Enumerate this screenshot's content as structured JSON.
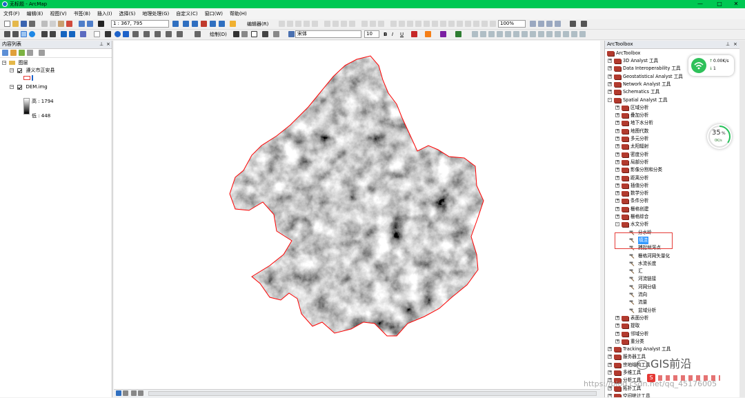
{
  "window": {
    "title": "无标题 - ArcMap",
    "controls": [
      "—",
      "□",
      "✕"
    ]
  },
  "menu": [
    "文件(F)",
    "编辑(E)",
    "视图(V)",
    "书签(B)",
    "插入(I)",
    "选择(S)",
    "地理处理(G)",
    "自定义(C)",
    "窗口(W)",
    "帮助(H)"
  ],
  "toolbar": {
    "scale": "1 : 367, 795",
    "editor_label": "编辑器(R)",
    "draw_label": "绘制(D)",
    "font_name": "宋体",
    "font_size": "10",
    "zoom_percent": "100%"
  },
  "toc": {
    "title": "内容列表",
    "layers_group": "图层",
    "layer1": "遵义市正安县",
    "layer2": "DEM.img",
    "high_label": "高 : 1794",
    "low_label": "低 : 448"
  },
  "toolbox": {
    "title": "ArcToolbox",
    "root": "ArcToolbox",
    "items": [
      {
        "level": 0,
        "exp": "+",
        "icon": "box",
        "label": "3D Analyst 工具"
      },
      {
        "level": 0,
        "exp": "+",
        "icon": "box",
        "label": "Data Interoperability 工具"
      },
      {
        "level": 0,
        "exp": "+",
        "icon": "box",
        "label": "Geostatistical Analyst 工具"
      },
      {
        "level": 0,
        "exp": "+",
        "icon": "box",
        "label": "Network Analyst 工具"
      },
      {
        "level": 0,
        "exp": "+",
        "icon": "box",
        "label": "Schematics 工具"
      },
      {
        "level": 0,
        "exp": "-",
        "icon": "box",
        "label": "Spatial Analyst 工具"
      },
      {
        "level": 1,
        "exp": "+",
        "icon": "box",
        "label": "区域分析"
      },
      {
        "level": 1,
        "exp": "+",
        "icon": "box",
        "label": "叠加分析"
      },
      {
        "level": 1,
        "exp": "+",
        "icon": "box",
        "label": "地下水分析"
      },
      {
        "level": 1,
        "exp": "+",
        "icon": "box",
        "label": "地图代数"
      },
      {
        "level": 1,
        "exp": "+",
        "icon": "box",
        "label": "多元分析"
      },
      {
        "level": 1,
        "exp": "+",
        "icon": "box",
        "label": "太阳辐射"
      },
      {
        "level": 1,
        "exp": "+",
        "icon": "box",
        "label": "密度分析"
      },
      {
        "level": 1,
        "exp": "+",
        "icon": "box",
        "label": "局部分析"
      },
      {
        "level": 1,
        "exp": "+",
        "icon": "box",
        "label": "影像分割和分类"
      },
      {
        "level": 1,
        "exp": "+",
        "icon": "box",
        "label": "距离分析"
      },
      {
        "level": 1,
        "exp": "+",
        "icon": "box",
        "label": "插值分析"
      },
      {
        "level": 1,
        "exp": "+",
        "icon": "box",
        "label": "数学分析"
      },
      {
        "level": 1,
        "exp": "+",
        "icon": "box",
        "label": "条件分析"
      },
      {
        "level": 1,
        "exp": "+",
        "icon": "box",
        "label": "栅格创建"
      },
      {
        "level": 1,
        "exp": "+",
        "icon": "box",
        "label": "栅格综合"
      },
      {
        "level": 1,
        "exp": "-",
        "icon": "box",
        "label": "水文分析"
      },
      {
        "level": 2,
        "exp": "",
        "icon": "hammer",
        "label": "分水岭"
      },
      {
        "level": 2,
        "exp": "",
        "icon": "hammer",
        "label": "填洼",
        "selected": true
      },
      {
        "level": 2,
        "exp": "",
        "icon": "hammer",
        "label": "捕捉倾泻点"
      },
      {
        "level": 2,
        "exp": "",
        "icon": "hammer",
        "label": "栅格河网矢量化"
      },
      {
        "level": 2,
        "exp": "",
        "icon": "hammer",
        "label": "水流长度"
      },
      {
        "level": 2,
        "exp": "",
        "icon": "hammer",
        "label": "汇"
      },
      {
        "level": 2,
        "exp": "",
        "icon": "hammer",
        "label": "河流链接"
      },
      {
        "level": 2,
        "exp": "",
        "icon": "hammer",
        "label": "河网分级"
      },
      {
        "level": 2,
        "exp": "",
        "icon": "hammer",
        "label": "流向"
      },
      {
        "level": 2,
        "exp": "",
        "icon": "hammer",
        "label": "流量"
      },
      {
        "level": 2,
        "exp": "",
        "icon": "hammer",
        "label": "盆域分析"
      },
      {
        "level": 1,
        "exp": "+",
        "icon": "box",
        "label": "表面分析"
      },
      {
        "level": 1,
        "exp": "+",
        "icon": "box",
        "label": "提取"
      },
      {
        "level": 1,
        "exp": "+",
        "icon": "box",
        "label": "邻域分析"
      },
      {
        "level": 1,
        "exp": "+",
        "icon": "box",
        "label": "重分类"
      },
      {
        "level": 0,
        "exp": "+",
        "icon": "box",
        "label": "Tracking Analyst 工具"
      },
      {
        "level": 0,
        "exp": "+",
        "icon": "box",
        "label": "服务器工具"
      },
      {
        "level": 0,
        "exp": "+",
        "icon": "box",
        "label": "宗地结构工具"
      },
      {
        "level": 0,
        "exp": "+",
        "icon": "box",
        "label": "多维工具"
      },
      {
        "level": 0,
        "exp": "+",
        "icon": "box",
        "label": "分析工具"
      },
      {
        "level": 0,
        "exp": "+",
        "icon": "box",
        "label": "拓扑工具"
      },
      {
        "level": 0,
        "exp": "+",
        "icon": "box",
        "label": "空间统计工具"
      }
    ]
  },
  "widgets": {
    "net_up": "0.00K/s",
    "net_down": "1",
    "cpu_percent": "35",
    "cpu_unit": "%",
    "cpu_rate": "0K/s"
  },
  "watermark": {
    "brand": "GIS前沿",
    "url": "https://blog.csdn.net/qq_45176005"
  },
  "colors": {
    "titlebar": "#00c853",
    "highlight": "#e53935",
    "boundary": "#ff0000",
    "toolbox_icon": "#b23a2e",
    "selection": "#3399ff"
  }
}
